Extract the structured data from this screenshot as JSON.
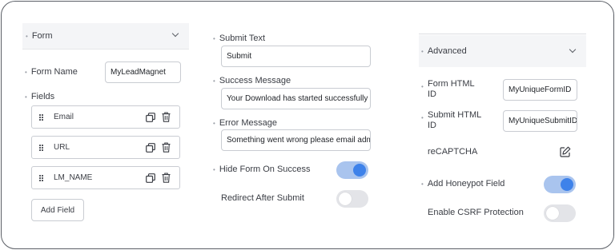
{
  "form_panel": {
    "title": "Form",
    "form_name_label": "Form Name",
    "form_name_value": "MyLeadMagnet",
    "fields_label": "Fields",
    "fields": [
      {
        "name": "Email"
      },
      {
        "name": "URL"
      },
      {
        "name": "LM_NAME"
      }
    ],
    "add_field_label": "Add Field"
  },
  "middle_panel": {
    "submit_text_label": "Submit Text",
    "submit_text_value": "Submit",
    "success_message_label": "Success Message",
    "success_message_value": "Your Download has started successfully",
    "error_message_label": "Error Message",
    "error_message_value": "Something went wrong please email admin",
    "hide_form_label": "Hide Form On Success",
    "hide_form_on": true,
    "redirect_label": "Redirect After Submit",
    "redirect_on": false
  },
  "advanced_panel": {
    "title": "Advanced",
    "form_html_id_label": "Form HTML ID",
    "form_html_id_value": "MyUniqueFormID",
    "submit_html_id_label": "Submit HTML ID",
    "submit_html_id_value": "MyUniqueSubmitID",
    "recaptcha_label": "reCAPTCHA",
    "honeypot_label": "Add Honeypot Field",
    "honeypot_on": true,
    "csrf_label": "Enable CSRF Protection",
    "csrf_on": false
  },
  "colors": {
    "toggle_on_track": "#a9c4ee",
    "toggle_on_knob": "#3e82ea",
    "toggle_off_track": "#e3e4e8",
    "panel_header_bg": "#f4f5f7"
  }
}
